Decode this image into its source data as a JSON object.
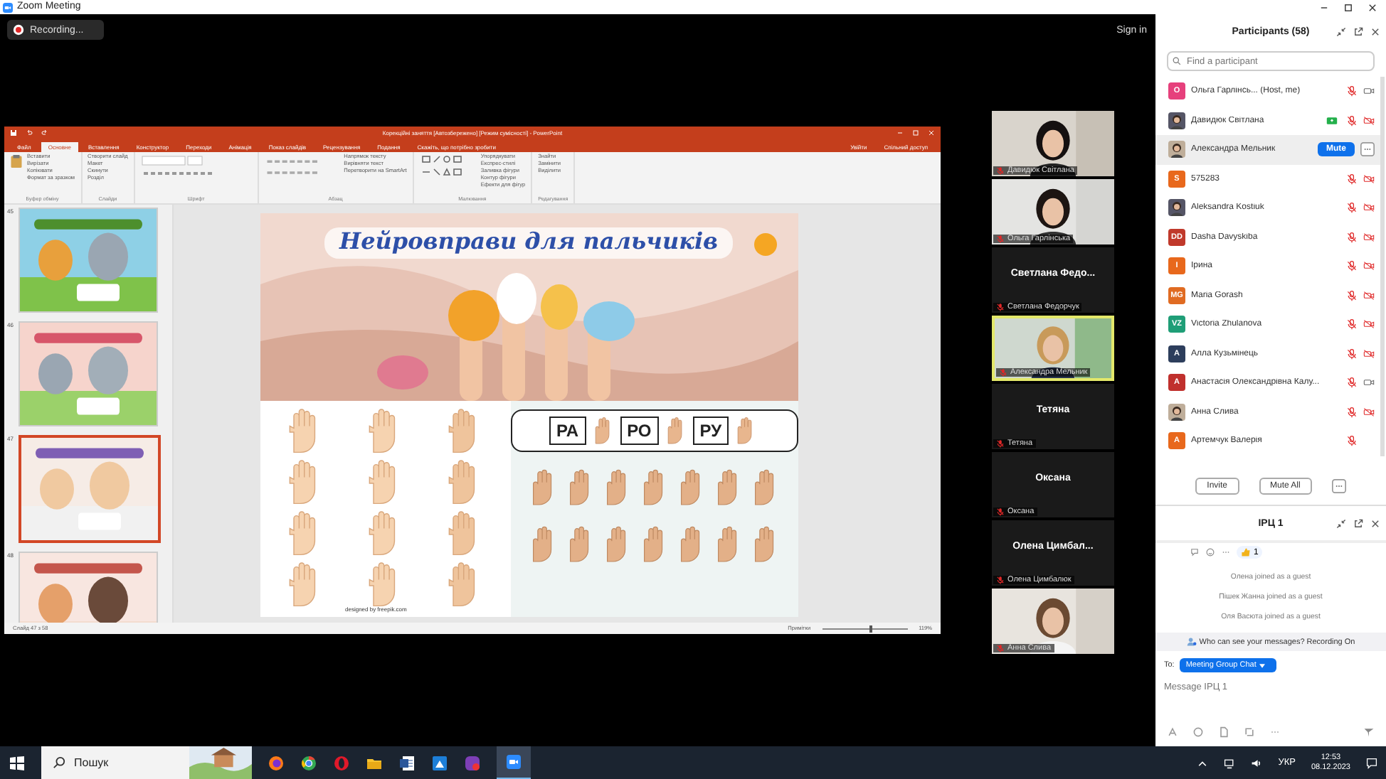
{
  "window": {
    "title": "Zoom Meeting"
  },
  "recording": {
    "label": "Recording..."
  },
  "sign_in": "Sign in",
  "powerpoint": {
    "title": "Корекційні заняття [Автозбережено] [Режим сумісності] - PowerPoint",
    "account": "Увійти",
    "share": "Спільний доступ",
    "tabs": [
      {
        "label": "Файл",
        "selected": false
      },
      {
        "label": "Основне",
        "selected": true
      },
      {
        "label": "Вставлення",
        "selected": false
      },
      {
        "label": "Конструктор",
        "selected": false
      },
      {
        "label": "Переходи",
        "selected": false
      },
      {
        "label": "Анімація",
        "selected": false
      },
      {
        "label": "Показ слайдів",
        "selected": false
      },
      {
        "label": "Рецензування",
        "selected": false
      },
      {
        "label": "Подання",
        "selected": false
      },
      {
        "label": "Скажіть, що потрібно зробити",
        "selected": false
      }
    ],
    "ribbon_groups": [
      {
        "label": "Буфер обміну",
        "commands": [
          "Вставити",
          "Вирізати",
          "Копіювати",
          "Формат за зразком"
        ]
      },
      {
        "label": "Слайди",
        "commands": [
          "Створити слайд",
          "Макет",
          "Скинути",
          "Розділ"
        ]
      },
      {
        "label": "Шрифт"
      },
      {
        "label": "Абзац",
        "commands": [
          "Напрямок тексту",
          "Вирівняти текст",
          "Перетворити на SmartArt"
        ]
      },
      {
        "label": "Малювання",
        "commands": [
          "Упорядкувати",
          "Експрес-стилі",
          "Заливка фігури",
          "Контур фігури",
          "Ефекти для фігур"
        ]
      },
      {
        "label": "Редагування",
        "commands": [
          "Знайти",
          "Замінити",
          "Виділити"
        ]
      }
    ],
    "thumbnails": [
      {
        "number": "45",
        "selected": false
      },
      {
        "number": "46",
        "selected": false
      },
      {
        "number": "47",
        "selected": true
      },
      {
        "number": "48",
        "selected": false
      }
    ],
    "slide": {
      "title": "Нейровправи для пальчиків",
      "syllables": [
        "РА",
        "РО",
        "РУ"
      ],
      "credit": "designed by freepik.com"
    },
    "status": {
      "slide": "Слайд 47 з 58",
      "notes": "Примітки",
      "zoom": "119%",
      "level": 0.55
    }
  },
  "gallery": [
    {
      "label": "Давидюк Світлана",
      "speaking": false
    },
    {
      "label": "Ольга Гарлінська",
      "speaking": false
    },
    {
      "kind": "name",
      "name": "Светлана  Федо...",
      "label": "Светлана Федорчук",
      "speaking": false
    },
    {
      "label": "Александра Мельник",
      "speaking": true
    },
    {
      "kind": "name",
      "name": "Тетяна",
      "label": "Тетяна",
      "speaking": false
    },
    {
      "kind": "name",
      "name": "Оксана",
      "label": "Оксана",
      "speaking": false
    },
    {
      "kind": "name",
      "name": "Олена  Цимбал...",
      "label": "Олена Цимбалюк",
      "speaking": false
    },
    {
      "label": "Анна Слива",
      "speaking": false
    }
  ],
  "participants": {
    "title": "Participants (58)",
    "search": {
      "placeholder": "Find a participant"
    },
    "items": [
      {
        "kind": "initials",
        "avatar": "О",
        "color": "#e6407c",
        "name": "Ольга Гарлінсь...  (Host, me)",
        "video_on": true
      },
      {
        "name": "Давидюк Світлана",
        "video_on": false,
        "sharing": true
      },
      {
        "name": "Александра Мельник",
        "action": "Mute"
      },
      {
        "kind": "initials",
        "avatar": "S",
        "color": "#e8681c",
        "name": "575283",
        "video_on": false
      },
      {
        "name": "Aleksandra Kostiuk",
        "video_on": false
      },
      {
        "kind": "initials",
        "avatar": "DD",
        "color": "#c0392b",
        "name": "Dasha Davyskiba",
        "video_on": false
      },
      {
        "kind": "initials",
        "avatar": "І",
        "color": "#e8681c",
        "name": "Ірина",
        "video_on": false
      },
      {
        "kind": "initials",
        "avatar": "MG",
        "color": "#e06b22",
        "name": "Maria Gorash",
        "video_on": false
      },
      {
        "kind": "initials",
        "avatar": "VZ",
        "color": "#1f9e77",
        "name": "Victoria Zhulanova",
        "video_on": false
      },
      {
        "kind": "initials",
        "avatar": "А",
        "color": "#2d3e5c",
        "name": "Алла Кузьмінець",
        "video_on": false
      },
      {
        "kind": "initials",
        "avatar": "А",
        "color": "#c0302d",
        "name": "Анастасія Олександрівна Калу...",
        "video_on": true
      },
      {
        "name": "Анна Слива",
        "video_on": false
      },
      {
        "kind": "initials",
        "avatar": "А",
        "color": "#e8681c",
        "name": "Артемчук Валерія"
      }
    ],
    "buttons": [
      "Invite",
      "Mute All"
    ]
  },
  "chat": {
    "title": "ІРЦ 1",
    "reaction_count": "1",
    "messages": [
      "Олена joined as a guest",
      "Пішек Жанна joined as a guest",
      "Оля Васюта joined as a guest"
    ],
    "notice": "Who can see your messages? Recording On",
    "to_label": "To:",
    "recipient": "Meeting Group Chat",
    "placeholder": "Message ІРЦ 1"
  },
  "taskbar": {
    "search": "Пошук",
    "language": "УКР",
    "time": "12:53",
    "date": "08.12.2023"
  }
}
